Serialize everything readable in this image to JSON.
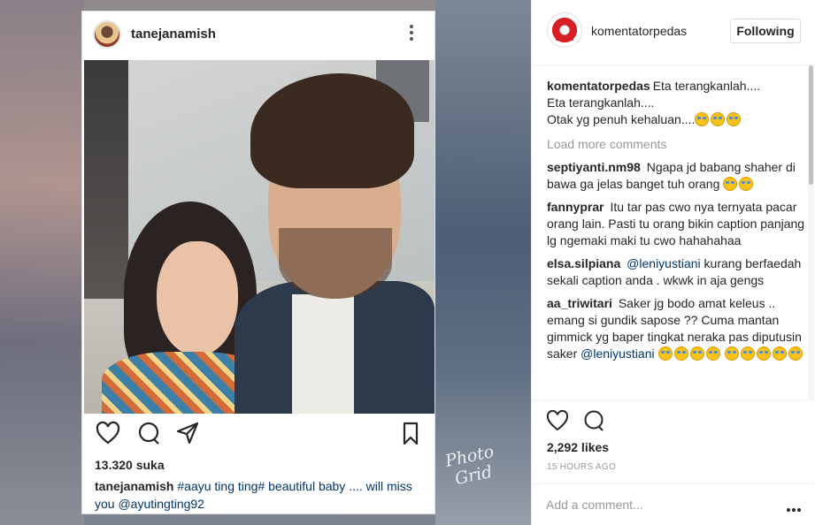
{
  "post_image": {
    "username": "tanejanamish",
    "likes": "13.320 suka",
    "caption_user": "tanejanamish",
    "caption_text": "#aayu ting ting# beautiful baby .... will miss you @ayutingting92",
    "watermark": "Photo Grid"
  },
  "header": {
    "username": "komentatorpedas",
    "follow_label": "Following"
  },
  "comments": {
    "caption": {
      "user": "komentatorpedas",
      "text": "Eta terangkanlah....\nEta terangkanlah....\nOtak yg penuh kehaluan...."
    },
    "load_more": "Load more comments",
    "items": [
      {
        "user": "septiyanti.nm98",
        "text": "Ngapa jd babang shaher di bawa ga jelas banget tuh orang"
      },
      {
        "user": "fannyprar",
        "text": "Itu tar pas cwo nya ternyata pacar orang lain. Pasti tu orang bikin caption panjang lg ngemaki maki tu cwo hahahahaa"
      },
      {
        "user": "elsa.silpiana",
        "mention": "@leniyustiani",
        "text": "kurang berfaedah sekali caption anda . wkwk in aja gengs"
      },
      {
        "user": "aa_triwitari",
        "text": "Saker jg bodo amat keleus .. emang si gundik sapose ?? Cuma mantan gimmick yg baper tingkat neraka pas diputusin saker",
        "mention": "@leniyustiani"
      }
    ]
  },
  "footer": {
    "likes": "2,292 likes",
    "time": "15 HOURS AGO",
    "add_comment_placeholder": "Add a comment..."
  },
  "icons": {
    "like": "heart-icon",
    "comment": "comment-icon",
    "share": "share-icon",
    "save": "bookmark-icon",
    "more": "more-options-icon",
    "emoji": "tears-of-joy-emoji"
  },
  "colors": {
    "text": "#262626",
    "muted": "#999999",
    "mention": "#003569",
    "border": "#efefef"
  }
}
